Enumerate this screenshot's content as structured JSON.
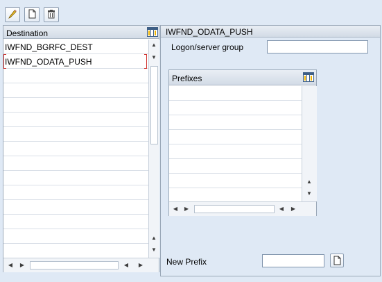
{
  "toolbar": {
    "buttons": [
      {
        "icon": "pencil-icon"
      },
      {
        "icon": "new-document-icon"
      },
      {
        "icon": "trash-icon"
      }
    ]
  },
  "destination_table": {
    "header": "Destination",
    "rows": [
      "IWFND_BGRFC_DEST",
      "IWFND_ODATA_PUSH"
    ]
  },
  "detail": {
    "title": "IWFND_ODATA_PUSH",
    "logon_label": "Logon/server group",
    "logon_value": "",
    "prefixes_header": "Prefixes",
    "new_prefix_label": "New Prefix",
    "new_prefix_value": ""
  },
  "colors": {
    "background": "#dfe9f5",
    "header": "#d2dbe6",
    "selection_marker": "#d0312d",
    "icon_yellow": "#f0b400"
  }
}
